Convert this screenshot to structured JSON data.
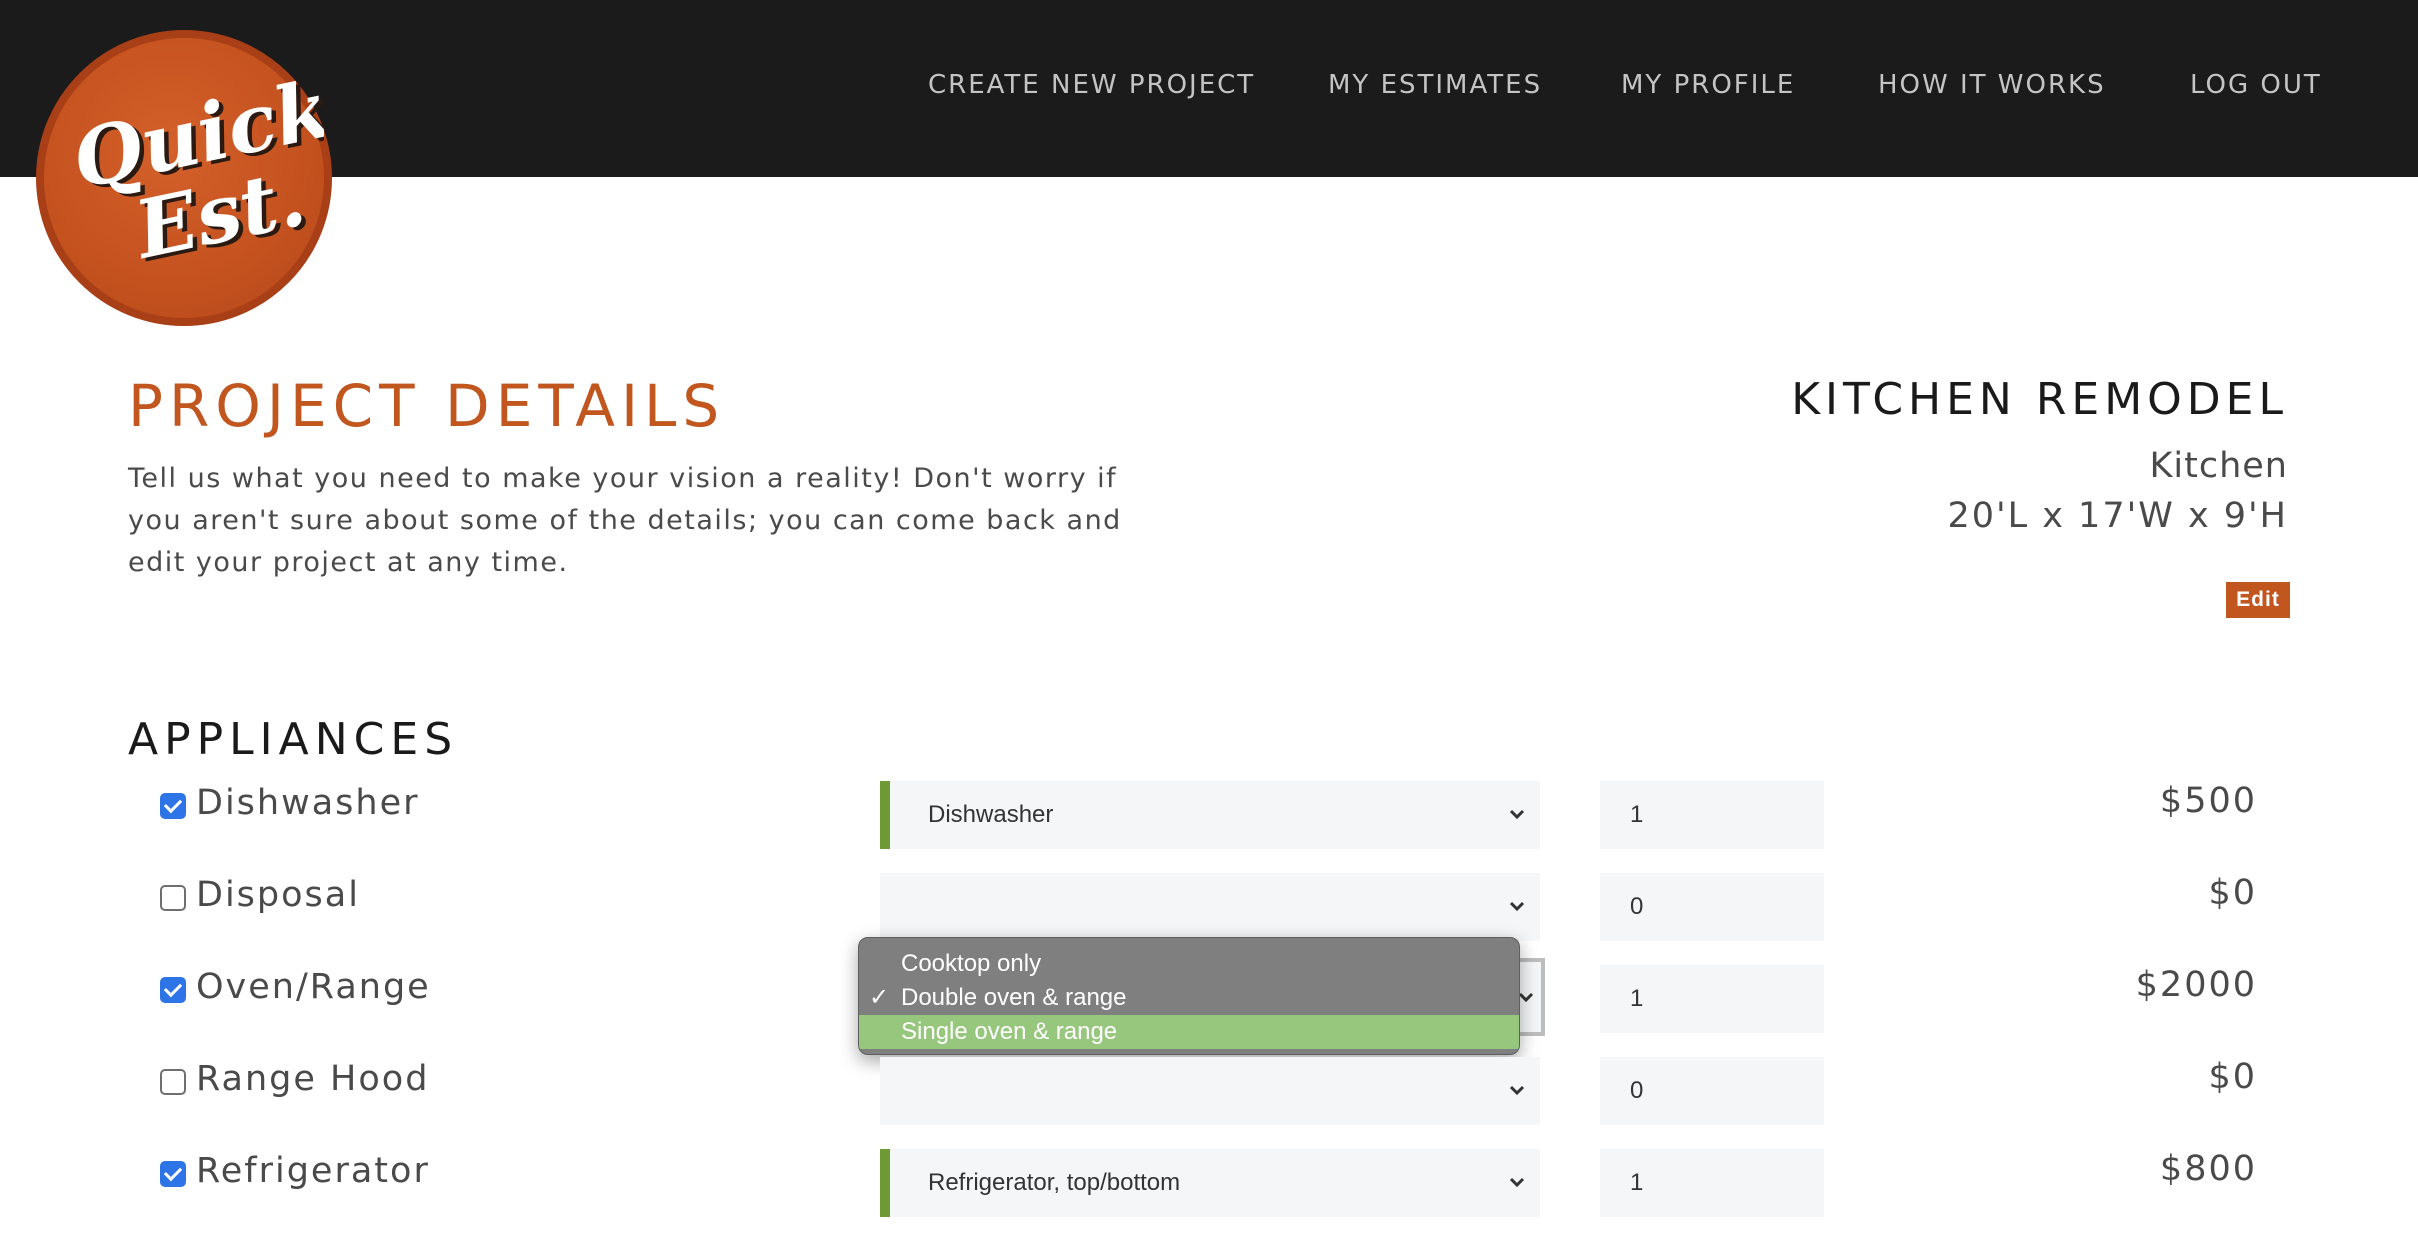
{
  "brand": {
    "logo_text_line1": "Quick",
    "logo_text_line2": "Est."
  },
  "nav": [
    {
      "label": "CREATE NEW PROJECT"
    },
    {
      "label": "MY ESTIMATES"
    },
    {
      "label": "MY PROFILE"
    },
    {
      "label": "HOW IT WORKS"
    },
    {
      "label": "LOG OUT"
    }
  ],
  "page": {
    "title": "PROJECT DETAILS",
    "intro": "Tell us what you need to make your vision a reality! Don't worry if you aren't sure about some of the details; you can come back and edit your project at any time."
  },
  "project": {
    "name": "KITCHEN REMODEL",
    "room": "Kitchen",
    "dimensions": "20'L x 17'W x 9'H",
    "edit_label": "Edit"
  },
  "appliances": {
    "title": "APPLIANCES",
    "items": [
      {
        "label": "Dishwasher",
        "checked": true,
        "selected_option": "Dishwasher",
        "quantity": "1",
        "price": "$500"
      },
      {
        "label": "Disposal",
        "checked": false,
        "selected_option": "",
        "quantity": "0",
        "price": "$0"
      },
      {
        "label": "Oven/Range",
        "checked": true,
        "selected_option": "Double oven & range",
        "quantity": "1",
        "price": "$2000"
      },
      {
        "label": "Range Hood",
        "checked": false,
        "selected_option": "",
        "quantity": "0",
        "price": "$0"
      },
      {
        "label": "Refrigerator",
        "checked": true,
        "selected_option": "Refrigerator, top/bottom",
        "quantity": "1",
        "price": "$800"
      }
    ]
  },
  "open_dropdown": {
    "options": [
      "Cooktop only",
      "Double oven & range",
      "Single oven & range"
    ],
    "checked_option": "Double oven & range",
    "highlighted_option": "Single oven & range",
    "check_mark": "✓"
  },
  "colors": {
    "brand_orange": "#c1561f",
    "topbar": "#1b1b1b",
    "selected_accent": "#6e9a36",
    "highlight": "#97c67d",
    "checkbox_blue": "#2d74e7"
  }
}
